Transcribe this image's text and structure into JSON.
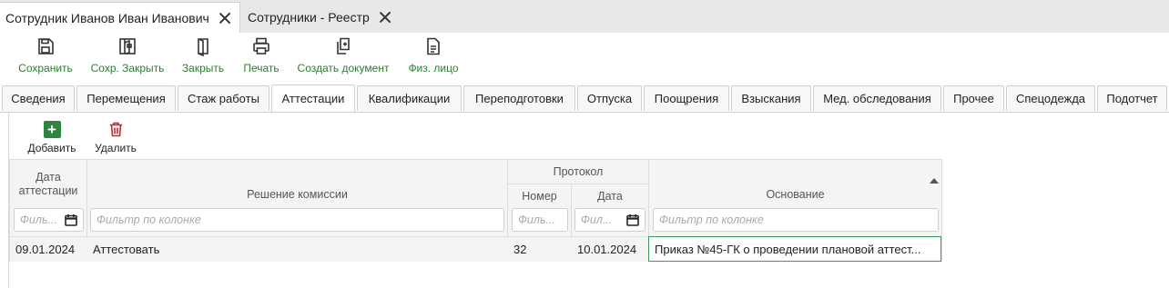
{
  "window_tabs": [
    {
      "label": "Сотрудник Иванов Иван Иванович",
      "active": true
    },
    {
      "label": "Сотрудники - Реестр",
      "active": false
    }
  ],
  "toolbar": {
    "save": "Сохранить",
    "save_close": "Сохр. Закрыть",
    "close": "Закрыть",
    "print": "Печать",
    "create_doc": "Создать документ",
    "individual": "Физ. лицо"
  },
  "section_tabs": [
    "Сведения",
    "Перемещения",
    "Стаж работы",
    "Аттестации",
    "Квалификации",
    "Переподготовки",
    "Отпуска",
    "Поощрения",
    "Взыскания",
    "Мед. обследования",
    "Прочее",
    "Спецодежда",
    "Подотчет"
  ],
  "active_section": "Аттестации",
  "actions": {
    "add": "Добавить",
    "delete": "Удалить"
  },
  "grid": {
    "headers": {
      "date": "Дата аттестации",
      "decision": "Решение комиссии",
      "protocol": "Протокол",
      "number": "Номер",
      "protocol_date": "Дата",
      "basis": "Основание"
    },
    "filters": {
      "date": "Филь...",
      "decision": "Фильтр по колонке",
      "number": "Филь...",
      "protocol_date": "Фил...",
      "basis": "Фильтр по колонке"
    },
    "rows": [
      {
        "date": "09.01.2024",
        "decision": "Аттестовать",
        "number": "32",
        "protocol_date": "10.01.2024",
        "basis": "Приказ №45-ГК о проведении плановой аттест..."
      }
    ]
  },
  "colors": {
    "accent_green": "#2e7d32",
    "add_green": "#2e8540",
    "delete_red": "#c62828"
  },
  "icons": [
    "close-icon",
    "save-icon",
    "save-close-icon",
    "close-doc-icon",
    "print-icon",
    "create-document-icon",
    "individual-icon",
    "plus-icon",
    "trash-icon",
    "calendar-icon",
    "sort-arrow-icon"
  ]
}
